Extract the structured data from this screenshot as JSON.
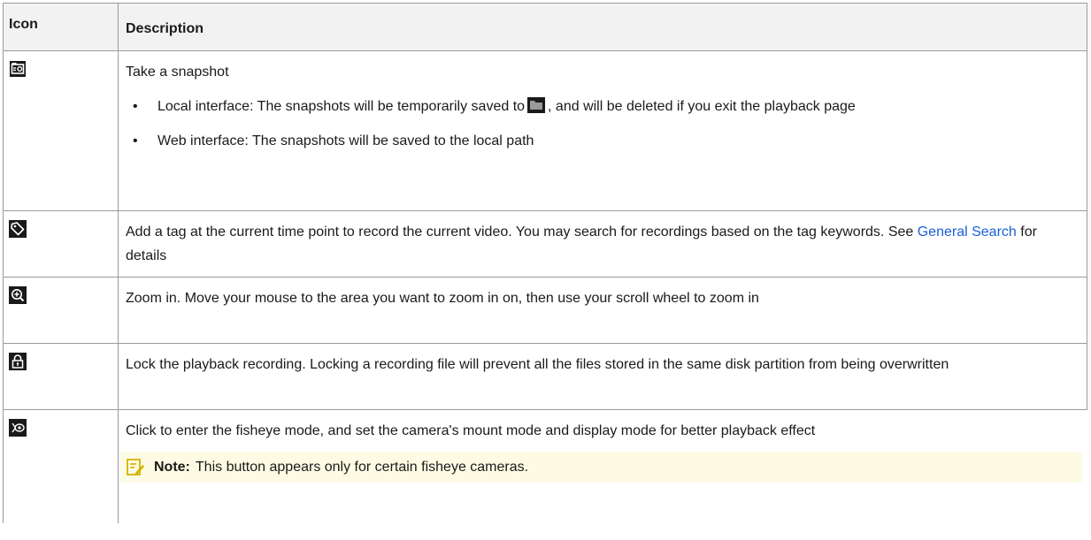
{
  "header": {
    "icon": "Icon",
    "description": "Description"
  },
  "rows": [
    {
      "icon": "snapshot-icon",
      "text": "Take a snapshot",
      "bullets": [
        {
          "pre": "Local interface: The snapshots will be temporarily saved to",
          "icon": "folder-icon",
          "post": ", and will be deleted if you exit the playback page"
        },
        {
          "text": "Web interface: The snapshots will be saved to the local path"
        }
      ]
    },
    {
      "icon": "tag-icon",
      "pre": "Add a tag at the current time point to record the current video. You may search for recordings based on the tag keywords. See ",
      "link": "General Search",
      "post": " for details"
    },
    {
      "icon": "zoom-in-icon",
      "text": "Zoom in. Move your mouse to the area you want to zoom in on, then use your scroll wheel to zoom in"
    },
    {
      "icon": "lock-icon",
      "text": "Lock the playback recording. Locking a recording file will prevent all the files stored in the same disk partition from being overwritten"
    },
    {
      "icon": "fisheye-icon",
      "text": "Click to enter the fisheye mode, and set the camera's mount mode and display mode for better playback effect",
      "note": {
        "label": "Note:",
        "text": "This button appears only for certain fisheye cameras."
      }
    }
  ],
  "colors": {
    "link": "#1a5fd6",
    "note_bg": "#fdfbe3",
    "header_bg": "#f2f2f2",
    "note_icon": "#d4b200"
  }
}
